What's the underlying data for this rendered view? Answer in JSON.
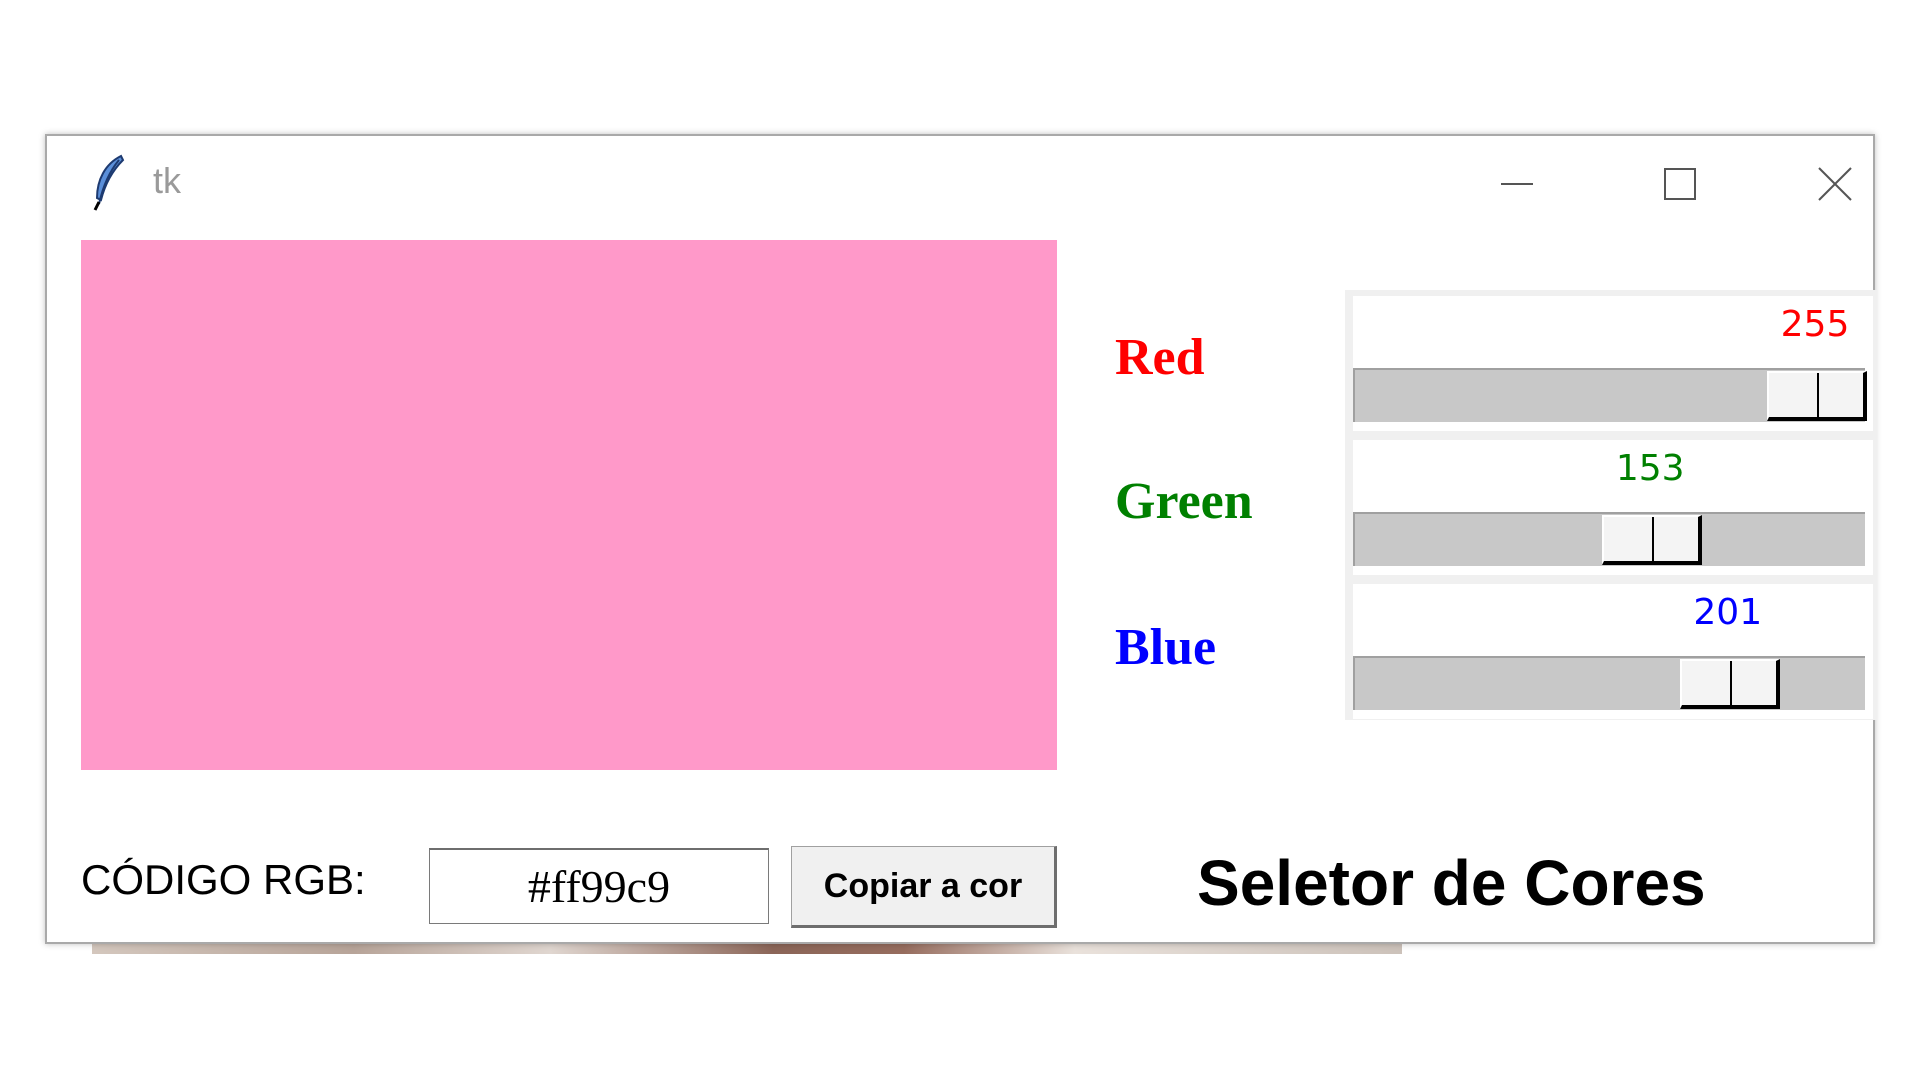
{
  "window": {
    "title": "tk",
    "icon": "feather-icon",
    "controls": {
      "minimize_icon": "minimize-icon",
      "maximize_icon": "maximize-icon",
      "close_icon": "close-icon"
    }
  },
  "preview": {
    "color": "#ff99c9"
  },
  "channels": {
    "red": {
      "label": "Red",
      "value": "255",
      "max": 255,
      "color": "#ff0000"
    },
    "green": {
      "label": "Green",
      "value": "153",
      "max": 255,
      "color": "#008000"
    },
    "blue": {
      "label": "Blue",
      "value": "201",
      "max": 255,
      "color": "#0000ff"
    }
  },
  "footer": {
    "rgb_label": "CÓDIGO RGB:",
    "hex_value": "#ff99c9",
    "copy_button": "Copiar a cor",
    "heading": "Seletor de Cores"
  }
}
